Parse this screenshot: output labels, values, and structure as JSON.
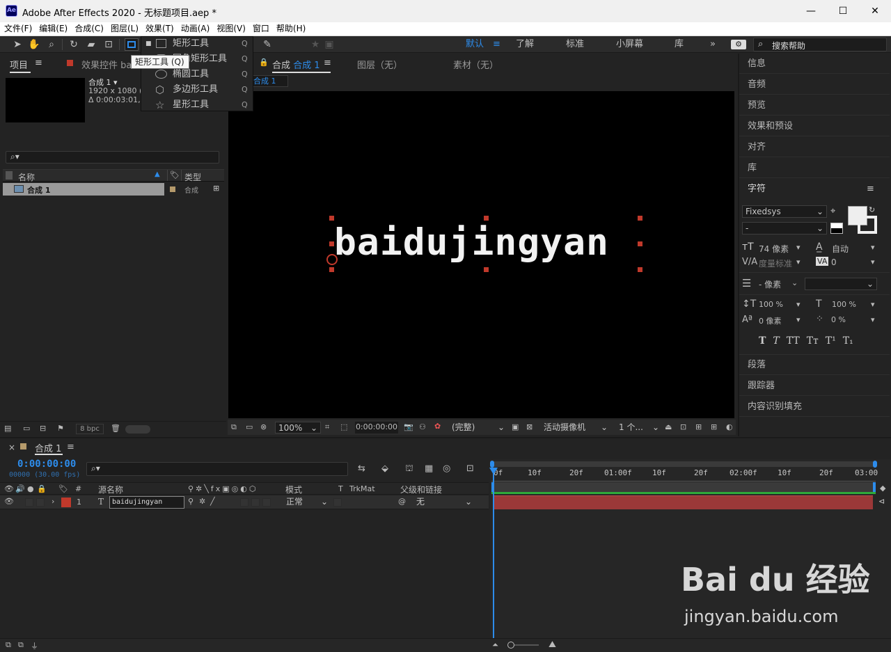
{
  "window": {
    "app_icon": "Ae",
    "title": "Adobe After Effects 2020 - 无标题项目.aep *",
    "controls": {
      "minimize": "—",
      "maximize": "☐",
      "close": "✕"
    }
  },
  "menu": [
    "文件(F)",
    "编辑(E)",
    "合成(C)",
    "图层(L)",
    "效果(T)",
    "动画(A)",
    "视图(V)",
    "窗口",
    "帮助(H)"
  ],
  "workspaces": {
    "items": [
      "默认",
      "了解",
      "标准",
      "小屏幕",
      "库"
    ],
    "active": "默认",
    "more": "»",
    "search_placeholder": "搜索帮助"
  },
  "tooltip": "矩形工具 (Q)",
  "shape_menu": {
    "items": [
      {
        "label": "矩形工具",
        "shortcut": "Q",
        "icon": "rectangle-icon"
      },
      {
        "label": "圆角矩形工具",
        "shortcut": "Q",
        "icon": "rounded-rectangle-icon"
      },
      {
        "label": "椭圆工具",
        "shortcut": "Q",
        "icon": "ellipse-icon"
      },
      {
        "label": "多边形工具",
        "shortcut": "Q",
        "icon": "polygon-icon"
      },
      {
        "label": "星形工具",
        "shortcut": "Q",
        "icon": "star-icon"
      }
    ]
  },
  "project_panel": {
    "tab_project": "项目",
    "tab_effects": "效果控件 bai",
    "comp_name": "合成 1",
    "comp_dims": "1920 x 1080 (1.",
    "comp_duration": "Δ 0:00:03:01, 30",
    "search_icon": "⌕▾",
    "col_name": "名称",
    "col_type": "类型",
    "rows": [
      {
        "name": "合成 1",
        "type": "合成"
      }
    ],
    "bpc": "8 bpc"
  },
  "comp_panel": {
    "lock": "🔒",
    "tab_label": "合成",
    "tab_comp": "合成 1",
    "tab_layer": "图层（无）",
    "tab_footage": "素材（无）",
    "breadcrumb": "合成 1",
    "canvas_text": "baidujingyan",
    "zoom": "100%",
    "timecode": "0:00:00:00",
    "quality": "(完整)",
    "camera": "活动摄像机",
    "views": "1 个..."
  },
  "right_panel": {
    "sections_top": [
      "信息",
      "音频",
      "预览",
      "效果和预设",
      "对齐",
      "库"
    ],
    "character_title": "字符",
    "font": "Fixedsys",
    "style": "-",
    "size": "74 像素",
    "leading": "自动",
    "kerning": "度量标准",
    "tracking": "0",
    "stroke": "- 像素",
    "vscale": "100 %",
    "hscale": "100 %",
    "baseline": "0 像素",
    "tsume": "0 %",
    "text_styles": [
      "T",
      "T",
      "TT",
      "Tт",
      "T¹",
      "T₁"
    ],
    "sections_bottom": [
      "段落",
      "跟踪器",
      "内容识别填充"
    ]
  },
  "timeline": {
    "close": "×",
    "tab": "合成 1",
    "menu": "≡",
    "timecode": "0:00:00:00",
    "fps": "00000 (30.00 fps)",
    "search_icon": "⌕▾",
    "col_hash": "#",
    "col_source": "源名称",
    "col_mode": "模式",
    "col_t": "T",
    "col_trkmat": "TrkMat",
    "col_parent": "父级和链接",
    "layer": {
      "num": "1",
      "type": "T",
      "name": "baidujingyan",
      "mode": "正常",
      "parent": "无"
    },
    "ruler_ticks": [
      "0f",
      "10f",
      "20f",
      "01:00f",
      "10f",
      "20f",
      "02:00f",
      "10f",
      "20f",
      "03:00"
    ]
  },
  "watermark": {
    "brand": "Bai du 经验",
    "url": "jingyan.baidu.com"
  },
  "colors": {
    "accent": "#2d8ceb",
    "label_red": "#c0392b",
    "label_tan": "#b59a6b",
    "workbar": "#9b3838"
  }
}
